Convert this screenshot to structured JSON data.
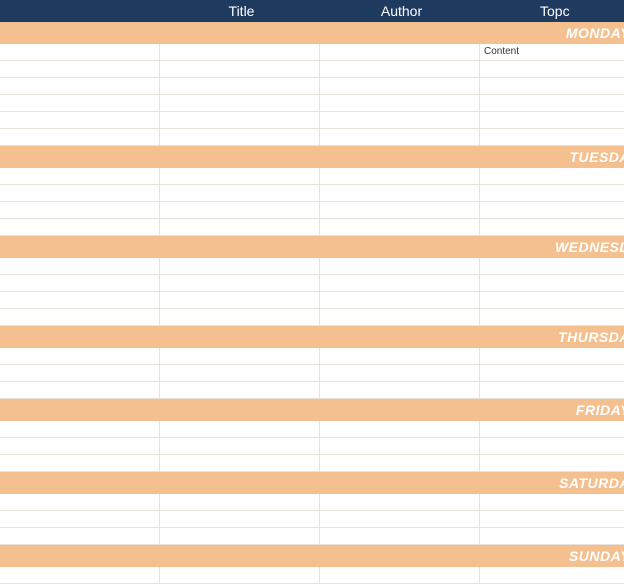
{
  "colors": {
    "header_bg": "#1f3a5f",
    "band_bg": "#f5c08f",
    "grid_line": "#e8e2da",
    "header_text": "#ffffff",
    "band_text": "#ffffff"
  },
  "header": {
    "columns": {
      "title": "Title",
      "author": "Author",
      "topic": "Topc"
    }
  },
  "sections": [
    {
      "day_label": "MONDAY",
      "rows": [
        {
          "title": "",
          "author": "",
          "topic": "Content"
        },
        {
          "title": "",
          "author": "",
          "topic": ""
        },
        {
          "title": "",
          "author": "",
          "topic": ""
        },
        {
          "title": "",
          "author": "",
          "topic": ""
        },
        {
          "title": "",
          "author": "",
          "topic": ""
        },
        {
          "title": "",
          "author": "",
          "topic": ""
        }
      ]
    },
    {
      "day_label": "TUESDA",
      "rows": [
        {
          "title": "",
          "author": "",
          "topic": ""
        },
        {
          "title": "",
          "author": "",
          "topic": ""
        },
        {
          "title": "",
          "author": "",
          "topic": ""
        },
        {
          "title": "",
          "author": "",
          "topic": ""
        }
      ]
    },
    {
      "day_label": "WEDNESD",
      "rows": [
        {
          "title": "",
          "author": "",
          "topic": ""
        },
        {
          "title": "",
          "author": "",
          "topic": ""
        },
        {
          "title": "",
          "author": "",
          "topic": ""
        },
        {
          "title": "",
          "author": "",
          "topic": ""
        }
      ]
    },
    {
      "day_label": "THURSDA",
      "rows": [
        {
          "title": "",
          "author": "",
          "topic": ""
        },
        {
          "title": "",
          "author": "",
          "topic": ""
        },
        {
          "title": "",
          "author": "",
          "topic": ""
        }
      ]
    },
    {
      "day_label": "FRIDAY",
      "rows": [
        {
          "title": "",
          "author": "",
          "topic": ""
        },
        {
          "title": "",
          "author": "",
          "topic": ""
        },
        {
          "title": "",
          "author": "",
          "topic": ""
        }
      ]
    },
    {
      "day_label": "SATURDA",
      "rows": [
        {
          "title": "",
          "author": "",
          "topic": ""
        },
        {
          "title": "",
          "author": "",
          "topic": ""
        },
        {
          "title": "",
          "author": "",
          "topic": ""
        }
      ]
    },
    {
      "day_label": "SUNDAY",
      "rows": [
        {
          "title": "",
          "author": "",
          "topic": ""
        }
      ]
    }
  ]
}
